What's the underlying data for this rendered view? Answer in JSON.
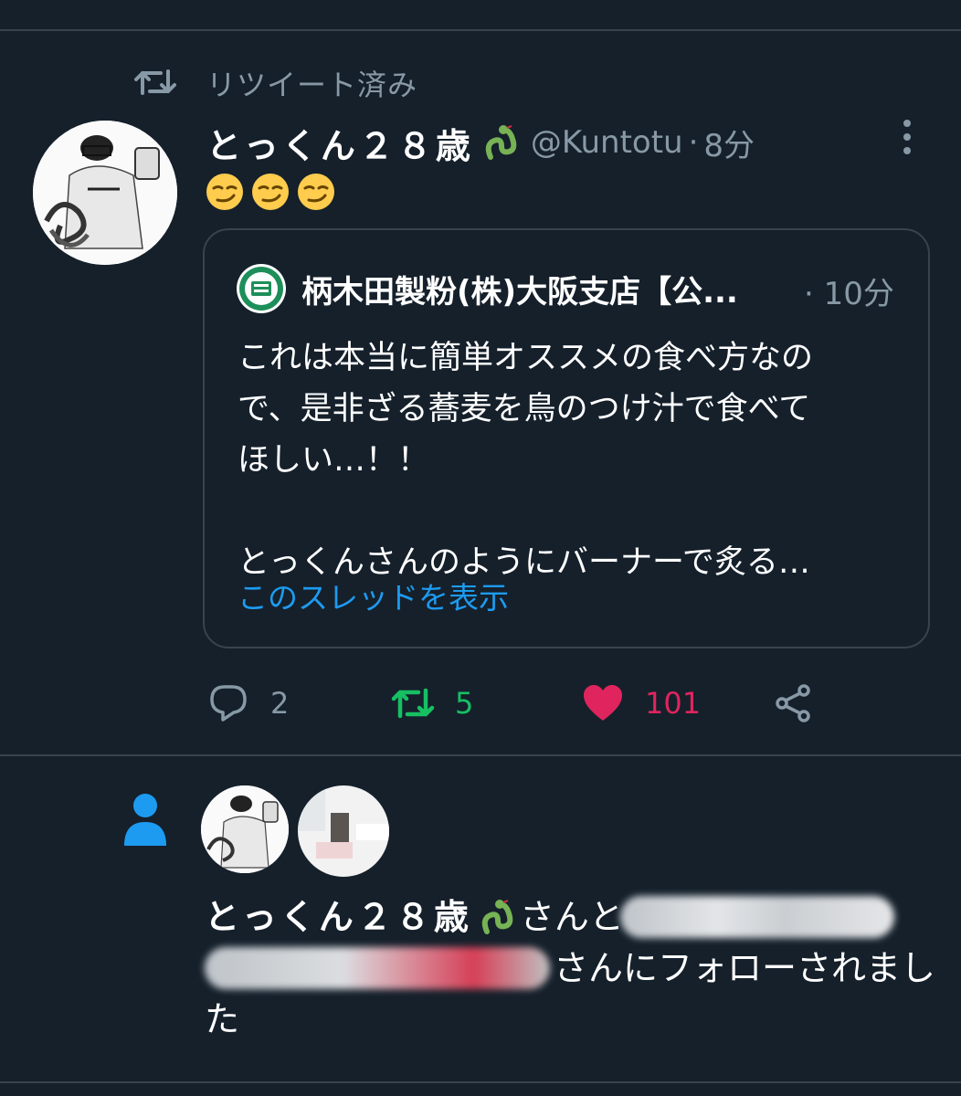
{
  "retweet_header": {
    "label": "リツイート済み"
  },
  "tweet": {
    "display_name": "とっくん２８歳",
    "handle": "@Kuntotu",
    "separator": "·",
    "time": "8分",
    "body_emojis": [
      "smirk-emoji",
      "smirk-emoji",
      "smirk-emoji"
    ],
    "quote": {
      "name": "柄木田製粉(株)大阪支店【公...",
      "time": "· 10分",
      "lines": [
        "これは本当に簡単オススメの食べ方なの",
        "で、是非ざる蕎麦を鳥のつけ汁で食べて",
        "ほしい…！！",
        "",
        "とっくんさんのようにバーナーで炙る…"
      ],
      "show_thread": "このスレッドを表示"
    },
    "actions": {
      "reply_count": "2",
      "retweet_count": "5",
      "like_count": "101"
    }
  },
  "follow_notification": {
    "name": "とっくん２８歳",
    "text_part1": "さんと",
    "text_part2": "さんにフォローされまし",
    "text_part3": "た"
  },
  "colors": {
    "background": "#15202b",
    "divider": "#38444d",
    "muted": "#8899a6",
    "link": "#1d9bf0",
    "retweet_green": "#17bf63",
    "like_pink": "#e0245e"
  }
}
